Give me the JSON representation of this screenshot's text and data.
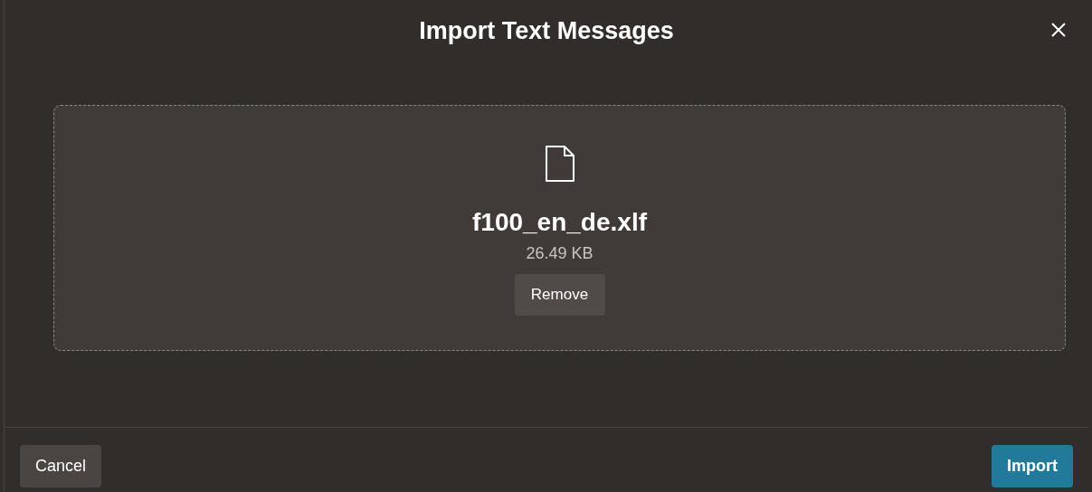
{
  "dialog": {
    "title": "Import Text Messages"
  },
  "dropzone": {
    "file_name": "f100_en_de.xlf",
    "file_size": "26.49 KB",
    "remove_label": "Remove"
  },
  "footer_buttons": [
    {
      "label": "Cancel",
      "kind": "secondary"
    },
    {
      "label": "Import",
      "kind": "primary"
    }
  ]
}
